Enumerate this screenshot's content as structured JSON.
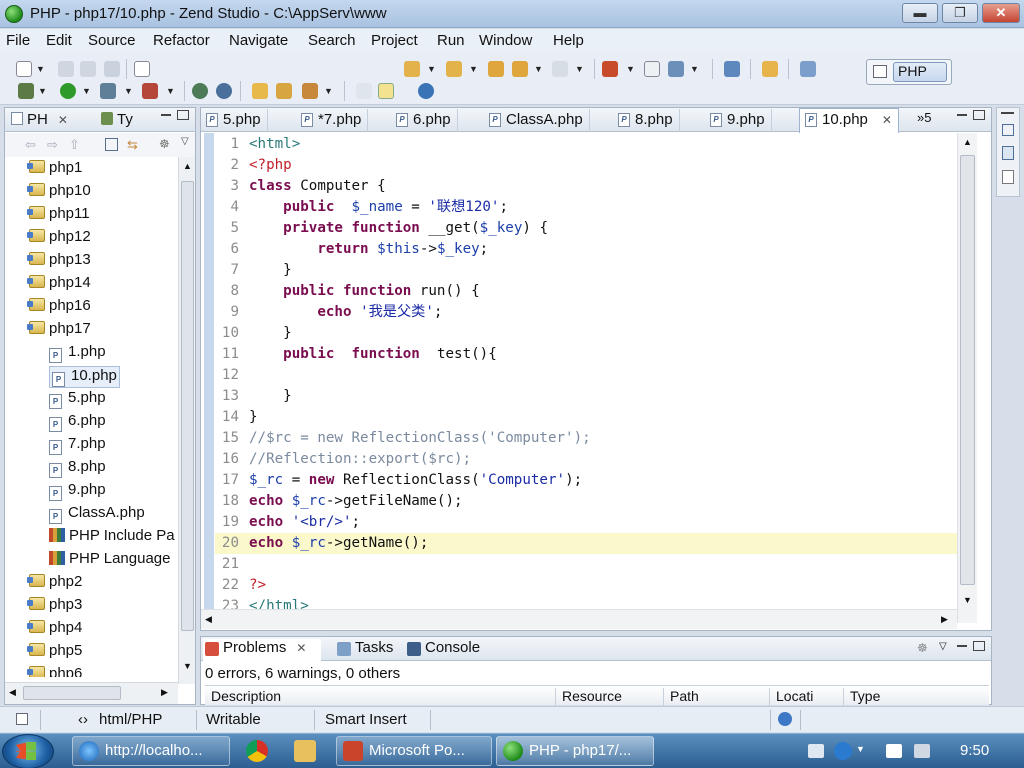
{
  "window": {
    "title": "PHP - php17/10.php - Zend Studio - C:\\AppServ\\www",
    "min": "▬",
    "max": "❐",
    "close": "✕"
  },
  "menu": [
    "File",
    "Edit",
    "Source",
    "Refactor",
    "Navigate",
    "Search",
    "Project",
    "Run",
    "Window",
    "Help"
  ],
  "perspective": {
    "label": "PHP"
  },
  "explorer": {
    "tabs": [
      "PH",
      "Ty"
    ],
    "items": [
      {
        "label": "php1",
        "type": "folder",
        "indent": 0
      },
      {
        "label": "php10",
        "type": "folder",
        "indent": 0
      },
      {
        "label": "php11",
        "type": "folder",
        "indent": 0
      },
      {
        "label": "php12",
        "type": "folder",
        "indent": 0
      },
      {
        "label": "php13",
        "type": "folder",
        "indent": 0
      },
      {
        "label": "php14",
        "type": "folder",
        "indent": 0
      },
      {
        "label": "php16",
        "type": "folder",
        "indent": 0
      },
      {
        "label": "php17",
        "type": "folder",
        "indent": 0
      },
      {
        "label": "1.php",
        "type": "file",
        "indent": 1
      },
      {
        "label": "10.php",
        "type": "file",
        "indent": 1,
        "selected": true
      },
      {
        "label": "5.php",
        "type": "file",
        "indent": 1
      },
      {
        "label": "6.php",
        "type": "file",
        "indent": 1
      },
      {
        "label": "7.php",
        "type": "file",
        "indent": 1
      },
      {
        "label": "8.php",
        "type": "file",
        "indent": 1
      },
      {
        "label": "9.php",
        "type": "file",
        "indent": 1
      },
      {
        "label": "ClassA.php",
        "type": "file",
        "indent": 1
      },
      {
        "label": "PHP Include Pa",
        "type": "lib",
        "indent": 1
      },
      {
        "label": "PHP Language",
        "type": "lib",
        "indent": 1
      },
      {
        "label": "php2",
        "type": "folder",
        "indent": 0
      },
      {
        "label": "php3",
        "type": "folder",
        "indent": 0
      },
      {
        "label": "php4",
        "type": "folder",
        "indent": 0
      },
      {
        "label": "php5",
        "type": "folder",
        "indent": 0
      },
      {
        "label": "php6",
        "type": "folder",
        "indent": 0
      }
    ]
  },
  "editor": {
    "tabs": [
      "5.php",
      "*7.php",
      "6.php",
      "ClassA.php",
      "8.php",
      "9.php",
      "10.php"
    ],
    "active_tab": "10.php",
    "overflow": "»5",
    "lines": [
      {
        "n": "1",
        "t": "<html>"
      },
      {
        "n": "2",
        "t": "<?php"
      },
      {
        "n": "3",
        "t": "class Computer {"
      },
      {
        "n": "4",
        "t": "    public  $_name = '联想120';"
      },
      {
        "n": "5",
        "t": "    private function __get($_key) {"
      },
      {
        "n": "6",
        "t": "        return $this->$_key;"
      },
      {
        "n": "7",
        "t": "    }"
      },
      {
        "n": "8",
        "t": "    public function run() {"
      },
      {
        "n": "9",
        "t": "        echo '我是父类';"
      },
      {
        "n": "10",
        "t": "    }"
      },
      {
        "n": "11",
        "t": "    public  function  test(){"
      },
      {
        "n": "12",
        "t": ""
      },
      {
        "n": "13",
        "t": "    }"
      },
      {
        "n": "14",
        "t": "}"
      },
      {
        "n": "15",
        "t": "//$rc = new ReflectionClass('Computer');"
      },
      {
        "n": "16",
        "t": "//Reflection::export($rc);"
      },
      {
        "n": "17",
        "t": "$_rc = new ReflectionClass('Computer');"
      },
      {
        "n": "18",
        "t": "echo $_rc->getFileName();"
      },
      {
        "n": "19",
        "t": "echo '<br/>';"
      },
      {
        "n": "20",
        "t": "echo $_rc->getName();"
      },
      {
        "n": "21",
        "t": ""
      },
      {
        "n": "22",
        "t": "?>"
      },
      {
        "n": "23",
        "t": "</html>"
      }
    ],
    "highlight_line": "20"
  },
  "bottom": {
    "tabs": [
      "Problems",
      "Tasks",
      "Console"
    ],
    "summary": "0 errors, 6 warnings, 0 others",
    "columns": [
      "Description",
      "Resource",
      "Path",
      "Locati",
      "Type"
    ]
  },
  "status": {
    "lang": "html/PHP",
    "mode": "Writable",
    "insert": "Smart Insert"
  },
  "taskbar": {
    "items": [
      "http://localho...",
      "Microsoft Po...",
      "PHP - php17/..."
    ],
    "clock": "9:50"
  },
  "colors": {
    "keyword": "#7a0d4f",
    "string": "#1b2ca6",
    "comment": "#7b8a9e",
    "highlight": "#fbf8cc",
    "taskbar": "#2c5e91"
  }
}
